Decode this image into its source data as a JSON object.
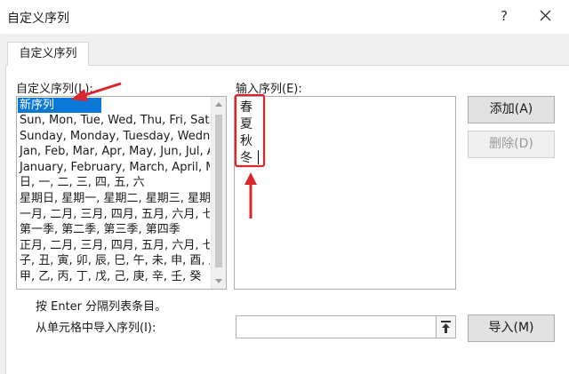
{
  "window": {
    "title": "自定义序列",
    "help_glyph": "?"
  },
  "tabs": [
    {
      "label": "自定义序列"
    }
  ],
  "lists_label": "自定义序列(L):",
  "lists": [
    "新序列",
    "Sun, Mon, Tue, Wed, Thu, Fri, Sat",
    "Sunday, Monday, Tuesday, Wedn",
    "Jan, Feb, Mar, Apr, May, Jun, Jul, A",
    "January, February, March, April, M",
    "日, 一, 二, 三, 四, 五, 六",
    "星期日, 星期一, 星期二, 星期三, 星期",
    "一月, 二月, 三月, 四月, 五月, 六月, 七",
    "第一季, 第二季, 第三季, 第四季",
    "正月, 二月, 三月, 四月, 五月, 六月, 七",
    "子, 丑, 寅, 卯, 辰, 巳, 午, 未, 申, 酉, 戌",
    "甲, 乙, 丙, 丁, 戊, 己, 庚, 辛, 壬, 癸"
  ],
  "entries_label": "输入序列(E):",
  "entries": [
    "春",
    "夏",
    "秋",
    "冬"
  ],
  "buttons": {
    "add": "添加(A)",
    "delete": "删除(D)",
    "import": "导入(M)"
  },
  "hint": "按 Enter 分隔列表条目。",
  "import_label": "从单元格中导入序列(I):",
  "import_value": "",
  "colors": {
    "accent": "#0a78d7",
    "annotation": "#d9262c"
  },
  "icons": [
    "close-icon",
    "range-picker-icon",
    "scroll-up-icon",
    "scroll-down-icon"
  ]
}
